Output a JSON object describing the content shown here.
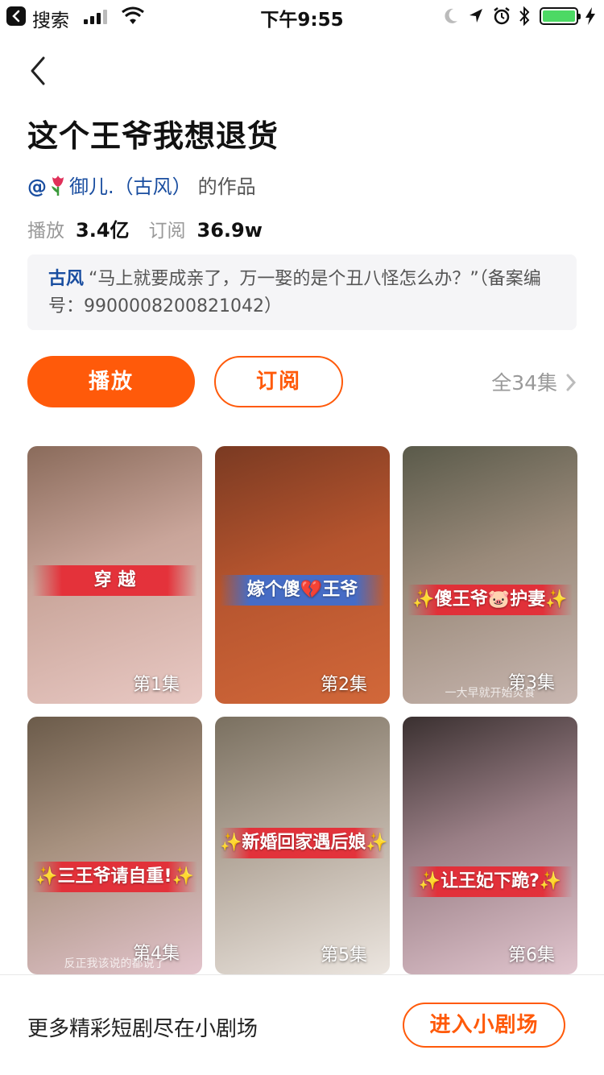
{
  "status_bar": {
    "back_app": "搜索",
    "time": "下午9:55",
    "battery_level": 1.0
  },
  "drama": {
    "title": "这个王爷我想退货",
    "author_at": "@",
    "author_name": "御儿.（古风）",
    "author_suffix": "的作品",
    "play_label": "播放",
    "play_count": "3.4亿",
    "subscribe_label": "订阅",
    "subscribe_count": "36.9w",
    "genre_tag": "古风",
    "description": "“马上就要成亲了，万一娶的是个丑八怪怎么办？”（备案编号：9900008200821042）"
  },
  "actions": {
    "play_button": "播放",
    "subscribe_button": "订阅",
    "all_episodes": "全34集"
  },
  "episodes": [
    {
      "label": "第1集",
      "banner": "穿 越",
      "bg": [
        "#8a6b5b",
        "#e9c9c4"
      ]
    },
    {
      "label": "第2集",
      "banner": "嫁个傻💔王爷",
      "bg": [
        "#7a3a22",
        "#d2683a"
      ]
    },
    {
      "label": "第3集",
      "banner": "✨傻王爷🐷护妻✨",
      "subtitle": "一大早就开始炎食",
      "bg": [
        "#5a5a4a",
        "#c9b7b1"
      ]
    },
    {
      "label": "第4集",
      "banner": "✨三王爷请自重!✨",
      "subtitle": "反正我该说的都说了",
      "bg": [
        "#6b5b4a",
        "#e3c4cc"
      ]
    },
    {
      "label": "第5集",
      "banner": "✨新婚回家遇后娘✨",
      "bg": [
        "#7a7060",
        "#ece6e0"
      ]
    },
    {
      "label": "第6集",
      "banner": "✨让王妃下跪?✨",
      "bg": [
        "#3a3030",
        "#e2c6cf"
      ]
    }
  ],
  "footer": {
    "promo_text": "更多精彩短剧尽在小剧场",
    "enter_button": "进入小剧场"
  },
  "colors": {
    "accent": "#ff5a0a",
    "link": "#1a4ea0",
    "battery": "#4cd964"
  }
}
